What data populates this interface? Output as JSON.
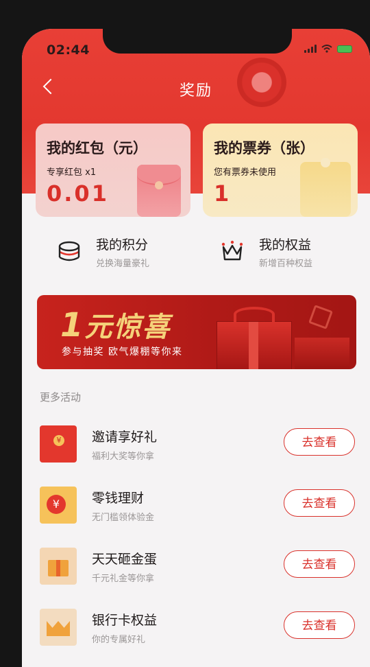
{
  "status_bar": {
    "time": "02:44"
  },
  "header": {
    "title": "奖励"
  },
  "cards": {
    "red_packet": {
      "title": "我的红包（元）",
      "sub": "专享红包 x1",
      "value": "0.01"
    },
    "tickets": {
      "title": "我的票券（张）",
      "sub": "您有票券未使用",
      "value": "1"
    }
  },
  "quick": {
    "points": {
      "title": "我的积分",
      "sub": "兑换海量豪礼",
      "icon": "coins-icon"
    },
    "rights": {
      "title": "我的权益",
      "sub": "新增百种权益",
      "icon": "crown-icon"
    }
  },
  "banner": {
    "main_big": "1",
    "main_rest": "元惊喜",
    "sub": "参与抽奖  欧气爆棚等你来"
  },
  "more_label": "更多活动",
  "activities": [
    {
      "title": "邀请享好礼",
      "sub": "福利大奖等你拿",
      "button": "去查看",
      "icon": "red-envelope-icon"
    },
    {
      "title": "零钱理财",
      "sub": "无门槛领体验金",
      "button": "去查看",
      "icon": "yuan-coin-icon"
    },
    {
      "title": "天天砸金蛋",
      "sub": "千元礼金等你拿",
      "button": "去查看",
      "icon": "gift-box-icon"
    },
    {
      "title": "银行卡权益",
      "sub": "你的专属好礼",
      "button": "去查看",
      "icon": "crown-icon"
    }
  ],
  "colors": {
    "primary_red": "#e3382f",
    "accent_gold": "#f5d27a"
  }
}
